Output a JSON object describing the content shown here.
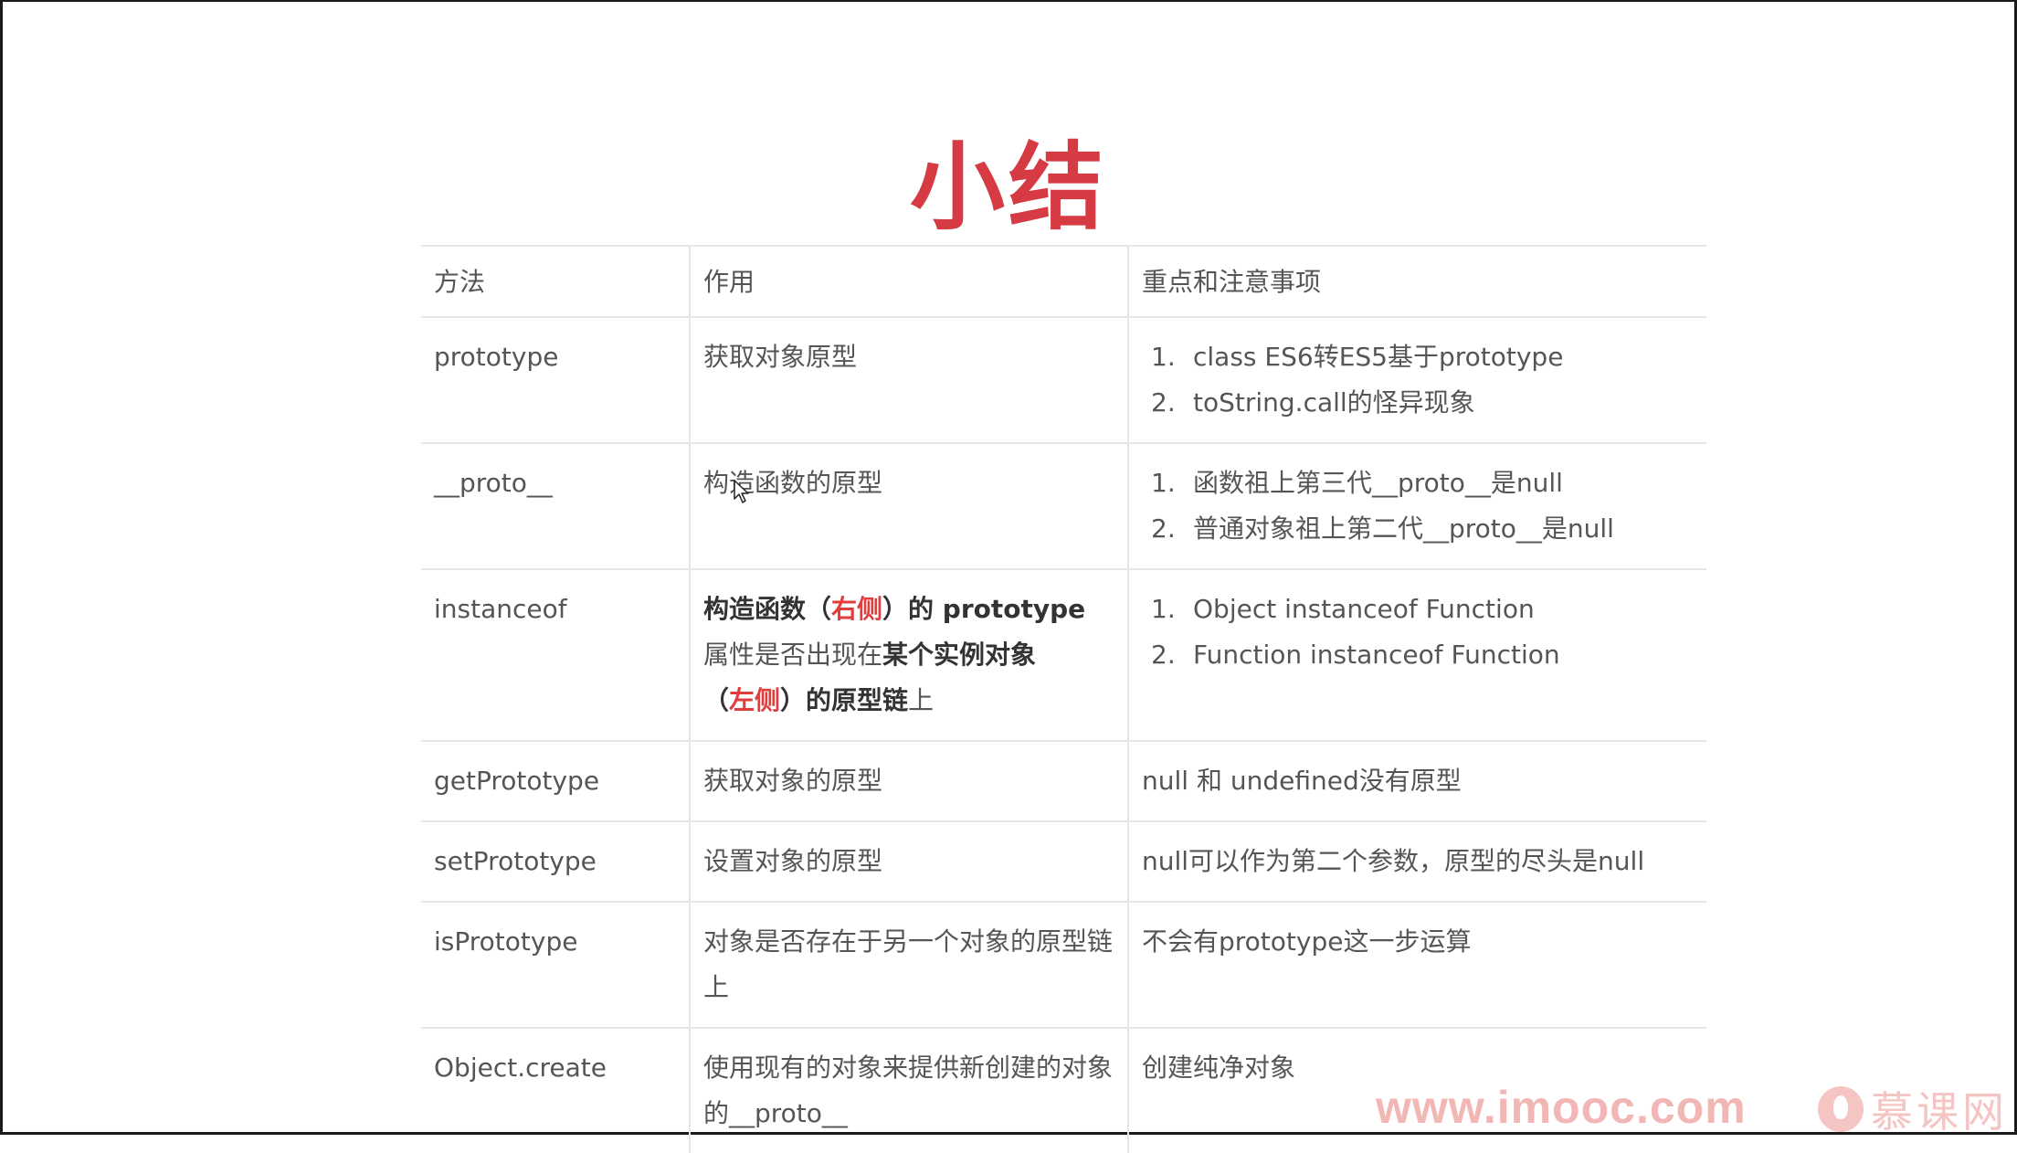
{
  "title": "小结",
  "table": {
    "headers": [
      "方法",
      "作用",
      "重点和注意事项"
    ],
    "rows": [
      {
        "method": "prototype",
        "purpose": "获取对象原型",
        "notes": [
          "1.",
          "class ES6转ES5基于prototype",
          "2.",
          "toString.call的怪异现象"
        ]
      },
      {
        "method": "__proto__",
        "purpose": "构造函数的原型",
        "notes": [
          "1.",
          "函数祖上第三代__proto__是null",
          "2.",
          "普通对象祖上第二代__proto__是null"
        ]
      },
      {
        "method": "instanceof",
        "purpose_parts": {
          "p1": "构造函数（",
          "p2": "右侧",
          "p3": "）的 prototype",
          "p4": "属性是否出现在",
          "p5": "某个实例对象",
          "p6": "（",
          "p7": "左侧",
          "p8": "）的原型链",
          "p9": "上"
        },
        "notes": [
          "1.",
          "Object instanceof Function",
          "2.",
          "Function instanceof Function"
        ]
      },
      {
        "method": "getPrototype",
        "purpose": "获取对象的原型",
        "note": "null 和 undefined没有原型"
      },
      {
        "method": "setPrototype",
        "purpose": "设置对象的原型",
        "note": "null可以作为第二个参数，原型的尽头是null"
      },
      {
        "method": "isPrototype",
        "purpose": "对象是否存在于另一个对象的原型链上",
        "note": "不会有prototype这一步运算"
      },
      {
        "method": "Object.create",
        "purpose": "使用现有的对象来提供新创建的对象的__proto__",
        "note": "创建纯净对象"
      }
    ]
  },
  "watermark": {
    "url": "www.imooc.com",
    "brand": "慕课网"
  },
  "colors": {
    "title": "#d63b44",
    "highlight": "#e23d3d"
  }
}
